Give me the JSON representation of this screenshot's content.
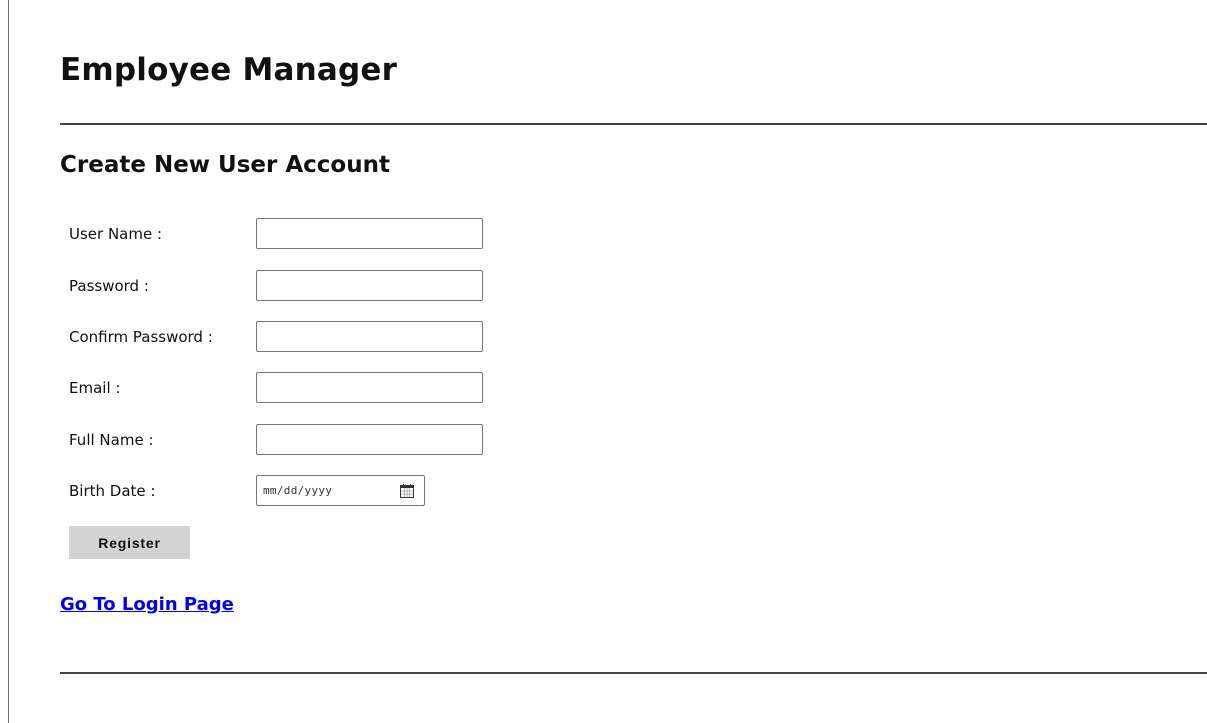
{
  "header": {
    "app_title": "Employee Manager"
  },
  "form": {
    "title": "Create New User Account",
    "fields": [
      {
        "label": "User Name :",
        "value": "",
        "placeholder": ""
      },
      {
        "label": "Password :",
        "value": "",
        "placeholder": ""
      },
      {
        "label": "Confirm Password :",
        "value": "",
        "placeholder": ""
      },
      {
        "label": "Email :",
        "value": "",
        "placeholder": ""
      },
      {
        "label": "Full Name :",
        "value": "",
        "placeholder": ""
      },
      {
        "label": "Birth Date :",
        "value": "mm/dd/yyyy",
        "icon": "calendar-icon"
      }
    ],
    "submit_label": "Register"
  },
  "footer": {
    "login_link": "Go To Login Page"
  },
  "colors": {
    "link": "#0000ee",
    "button_bg": "#d3d3d3",
    "rule": "#444444"
  }
}
